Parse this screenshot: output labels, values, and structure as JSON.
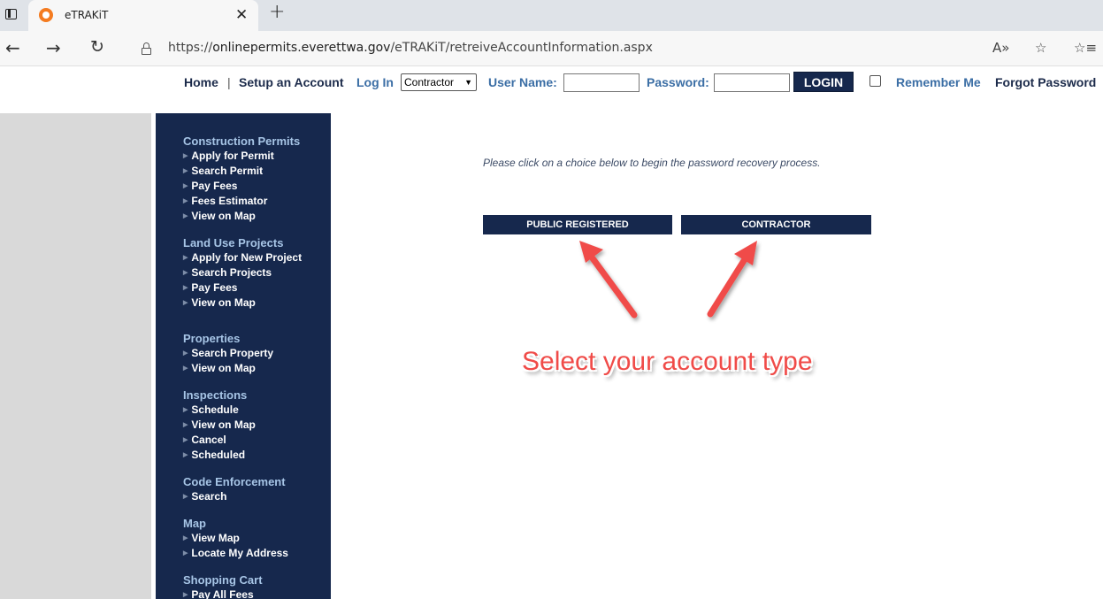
{
  "browser": {
    "tab_title": "eTRAKiT",
    "url_prefix": "https://",
    "url_host": "onlinepermits.everettwa.gov",
    "url_path": "/eTRAKiT/retreiveAccountInformation.aspx"
  },
  "loginbar": {
    "home": "Home",
    "separator": "|",
    "setup_account": "Setup an Account",
    "log_in": "Log In",
    "account_type_selected": "Contractor",
    "username_label": "User Name:",
    "password_label": "Password:",
    "login_button": "LOGIN",
    "remember_me": "Remember Me",
    "forgot_password": "Forgot Password"
  },
  "sidebar": {
    "sections": [
      {
        "title": "Construction Permits",
        "items": [
          "Apply for Permit",
          "Search Permit",
          "Pay Fees",
          "Fees Estimator",
          "View on Map"
        ]
      },
      {
        "title": "Land Use Projects",
        "items": [
          "Apply for New Project",
          "Search Projects",
          "Pay Fees",
          "View on Map"
        ]
      },
      {
        "title": "Properties",
        "items": [
          "Search Property",
          "View on Map"
        ]
      },
      {
        "title": "Inspections",
        "items": [
          "Schedule",
          "View on Map",
          "Cancel",
          "Scheduled"
        ]
      },
      {
        "title": "Code Enforcement",
        "items": [
          "Search"
        ]
      },
      {
        "title": "Map",
        "items": [
          "View Map",
          "Locate My Address"
        ]
      },
      {
        "title": "Shopping Cart",
        "items": [
          "Pay All Fees"
        ]
      }
    ]
  },
  "main": {
    "instruction": "Please click on a choice below to begin the password recovery process.",
    "choice_public": "PUBLIC REGISTERED",
    "choice_contractor": "CONTRACTOR",
    "annotation": "Select your account type"
  },
  "colors": {
    "navy": "#16284d",
    "link_blue": "#3b6ea5",
    "annotation_red": "#f04b48"
  }
}
